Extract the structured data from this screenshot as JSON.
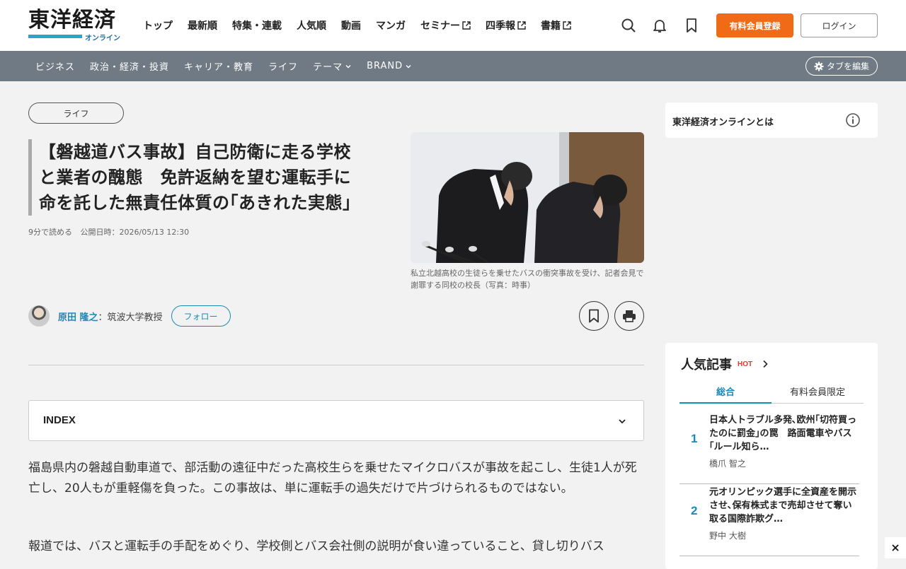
{
  "header": {
    "logo_main": "東洋経済",
    "logo_sub": "オンライン",
    "nav": [
      {
        "label": "トップ",
        "external": false
      },
      {
        "label": "最新順",
        "external": false
      },
      {
        "label": "特集・連載",
        "external": false
      },
      {
        "label": "人気順",
        "external": false
      },
      {
        "label": "動画",
        "external": false
      },
      {
        "label": "マンガ",
        "external": false
      },
      {
        "label": "セミナー",
        "external": true
      },
      {
        "label": "四季報",
        "external": true
      },
      {
        "label": "書籍",
        "external": true
      }
    ],
    "icons": [
      "search-icon",
      "bell-icon",
      "bookmark-icon"
    ],
    "register_label": "有料会員登録",
    "login_label": "ログイン",
    "accent_color": "#f06a18"
  },
  "subnav": {
    "items": [
      {
        "label": "ビジネス",
        "dropdown": false
      },
      {
        "label": "政治・経済・投資",
        "dropdown": false
      },
      {
        "label": "キャリア・教育",
        "dropdown": false
      },
      {
        "label": "ライフ",
        "dropdown": false
      },
      {
        "label": "テーマ",
        "dropdown": true
      },
      {
        "label": "BRAND",
        "dropdown": true
      }
    ],
    "tab_edit_label": "タブを編集",
    "background": "#6f7a85"
  },
  "article": {
    "category": "ライフ",
    "title_lines": [
      "【磐越道バス事故】自己防衛に走る学校",
      "と業者の醜態　免許返納を望む運転手に",
      "命を託した無責任体質の｢あきれた実態｣"
    ],
    "read_time": "9分で読める",
    "published": "公開日時：2026/05/13 12:30",
    "caption": "私立北越高校の生徒らを乗せたバスの衝突事故を受け、記者会見で謝罪する同校の校長（写真：時事）",
    "author_name": "原田 隆之",
    "author_title": "：筑波大学教授",
    "follow_label": "フォロー",
    "index_label": "INDEX",
    "paragraphs": [
      "福島県内の磐越自動車道で、部活動の遠征中だった高校生らを乗せたマイクロバスが事故を起こし、生徒1人が死亡し、20人もが重軽傷を負った。この事故は、単に運転手の過失だけで片づけられるものではない。",
      "報道では、バスと運転手の手配をめぐり、学校側とバス会社側の説明が食い違っていること、貸し切りバス"
    ]
  },
  "sidebar": {
    "about_label": "東洋経済オンラインとは",
    "popular_title": "人気記事",
    "popular_hot": "HOT",
    "tabs": [
      "総合",
      "有料会員限定"
    ],
    "items": [
      {
        "rank": "1",
        "headline": "日本人トラブル多発､欧州｢切符買ったのに罰金｣の罠　路面電車やバス｢ルール知ら…",
        "author": "橋爪 智之"
      },
      {
        "rank": "2",
        "headline": "元オリンピック選手に全資産を開示させ､保有株式まで売却させて奪い取る国際詐欺グ…",
        "author": "野中 大樹"
      }
    ]
  }
}
